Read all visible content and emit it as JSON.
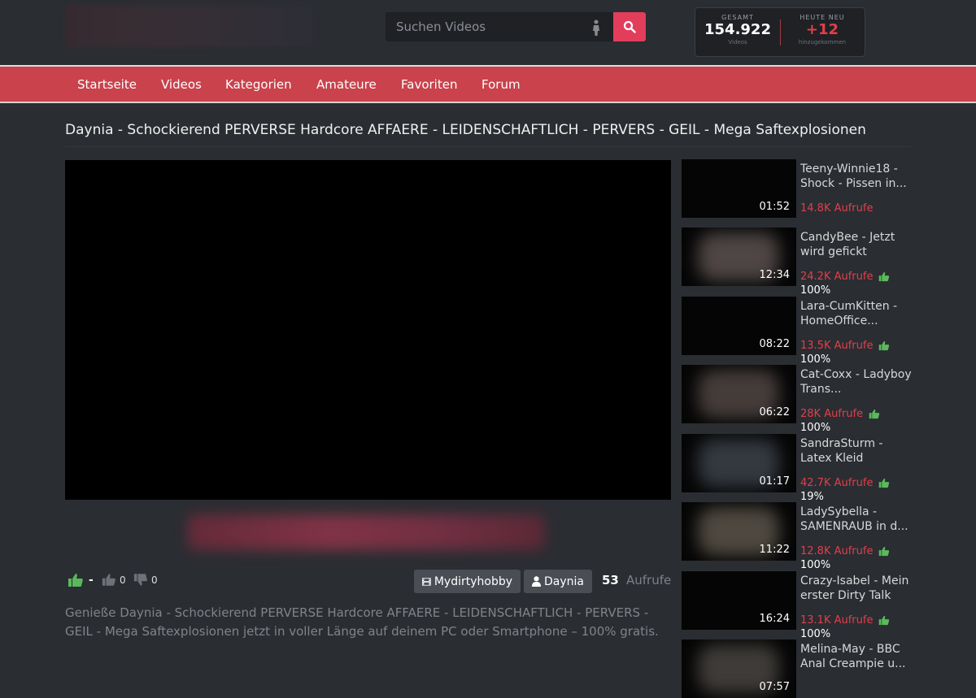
{
  "header": {
    "search_placeholder": "Suchen Videos",
    "stats": {
      "total_caption": "GESAMT",
      "total_value": "154.922",
      "total_sub": "Videos",
      "new_caption": "HEUTE NEU",
      "new_value": "+12",
      "new_sub": "hinzugekommen"
    }
  },
  "nav": [
    "Startseite",
    "Videos",
    "Kategorien",
    "Amateure",
    "Favoriten",
    "Forum"
  ],
  "video": {
    "title": "Daynia - Schockierend PERVERSE Hardcore AFFAERE - LEIDENSCHAFTLICH - PERVERS - GEIL - Mega Saftexplosionen",
    "rating_value": "-",
    "likes": "0",
    "dislikes": "0",
    "studio_tag": "Mydirtyhobby",
    "performer_tag": "Daynia",
    "views_count": "53",
    "views_label": "Aufrufe",
    "description": "Genieße Daynia - Schockierend PERVERSE Hardcore AFFAERE - LEIDENSCHAFTLICH - PERVERS - GEIL - Mega Saftexplosionen jetzt in voller Länge auf deinem PC oder Smartphone – 100% gratis."
  },
  "related": [
    {
      "title": "Teeny-Winnie18 - Shock - Pissen in...",
      "duration": "01:52",
      "views": "14.8K Aufrufe",
      "rating": ""
    },
    {
      "title": "CandyBee - Jetzt wird gefickt",
      "duration": "12:34",
      "views": "24.2K Aufrufe",
      "rating": "100%"
    },
    {
      "title": "Lara-CumKitten - HomeOffice...",
      "duration": "08:22",
      "views": "13.5K Aufrufe",
      "rating": "100%"
    },
    {
      "title": "Cat-Coxx - Ladyboy Trans...",
      "duration": "06:22",
      "views": "28K Aufrufe",
      "rating": "100%"
    },
    {
      "title": "SandraSturm - Latex Kleid",
      "duration": "01:17",
      "views": "42.7K Aufrufe",
      "rating": "19%"
    },
    {
      "title": "LadySybella - SAMENRAUB in d...",
      "duration": "11:22",
      "views": "12.8K Aufrufe",
      "rating": "100%"
    },
    {
      "title": "Crazy-Isabel - Mein erster Dirty Talk",
      "duration": "16:24",
      "views": "13.1K Aufrufe",
      "rating": "100%"
    },
    {
      "title": "Melina-May - BBC Anal Creampie u...",
      "duration": "07:57",
      "views": "",
      "rating": ""
    }
  ],
  "colors": {
    "accent_red": "#c9424c",
    "search_button": "#e33d5c",
    "views_red": "#e0404a",
    "thumb_green": "#5cb85c"
  },
  "icons": {
    "search": "magnifier-icon",
    "thumbs_up": "thumbs-up-icon",
    "thumbs_down": "thumbs-down-icon",
    "film": "film-icon",
    "user": "user-icon"
  }
}
